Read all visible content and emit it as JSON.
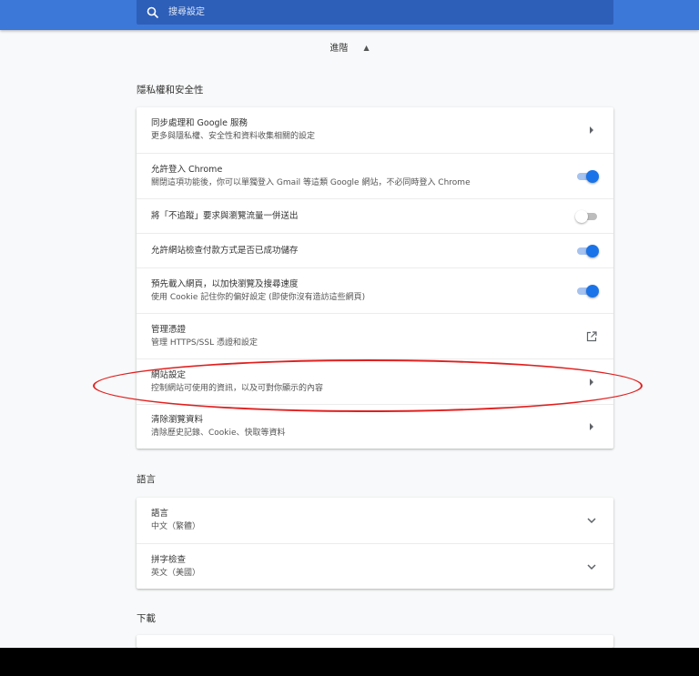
{
  "search": {
    "placeholder": "搜尋設定"
  },
  "advanced": {
    "label": "進階"
  },
  "privacy": {
    "title": "隱私權和安全性",
    "rows": [
      {
        "primary": "同步處理和 Google 服務",
        "secondary": "更多與隱私權、安全性和資料收集相關的設定",
        "control": "arrow"
      },
      {
        "primary": "允許登入 Chrome",
        "secondary": "關閉這項功能後，你可以單獨登入 Gmail 等這類 Google 網站，不必同時登入 Chrome",
        "control": "toggle",
        "on": true
      },
      {
        "primary": "將「不追蹤」要求與瀏覽流量一併送出",
        "secondary": "",
        "control": "toggle",
        "on": false
      },
      {
        "primary": "允許網站檢查付款方式是否已成功儲存",
        "secondary": "",
        "control": "toggle",
        "on": true
      },
      {
        "primary": "預先載入網頁，以加快瀏覽及搜尋速度",
        "secondary": "使用 Cookie 記住你的偏好設定 (即使你沒有造訪這些網頁)",
        "control": "toggle",
        "on": true
      },
      {
        "primary": "管理憑證",
        "secondary": "管理 HTTPS/SSL 憑證和設定",
        "control": "external"
      },
      {
        "primary": "網站設定",
        "secondary": "控制網站可使用的資訊，以及可對你顯示的內容",
        "control": "arrow"
      },
      {
        "primary": "清除瀏覽資料",
        "secondary": "清除歷史記錄、Cookie、快取等資料",
        "control": "arrow"
      }
    ]
  },
  "languages": {
    "title": "語言",
    "rows": [
      {
        "primary": "語言",
        "secondary": "中文（繁體）",
        "control": "expand"
      },
      {
        "primary": "拼字檢查",
        "secondary": "英文（美國）",
        "control": "expand"
      }
    ]
  },
  "downloads": {
    "title": "下載"
  },
  "colors": {
    "header": "#3c78d8",
    "toggle_on": "#1a73e8",
    "highlight": "#e0201f"
  }
}
